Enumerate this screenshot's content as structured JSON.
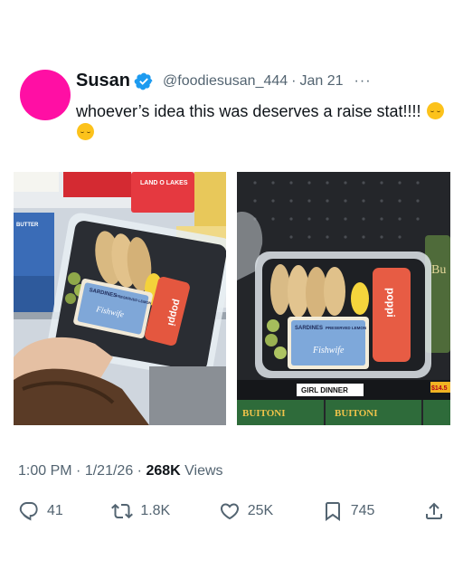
{
  "tweet": {
    "author": {
      "display_name": "Susan",
      "handle": "@foodiesusan_444",
      "verified": true,
      "avatar_color": "#ff0fa4"
    },
    "date": "Jan 21",
    "separator": "·",
    "text": "whoever’s idea this was deserves a raise stat!!!!",
    "emoji": [
      "relieved-face",
      "relieved-face"
    ],
    "media": {
      "left": {
        "labels": [
          "LAND O LAKES",
          "BUTTER",
          "SARDINES",
          "PRESERVED LEMON",
          "Fishwife",
          "poppi"
        ]
      },
      "right": {
        "labels": [
          "SARDINES",
          "PRESERVED LEMON",
          "Fishwife",
          "poppi",
          "GIRL DINNER",
          "BUITONI",
          "BUITONI",
          "$14.5",
          "Bu"
        ]
      }
    },
    "posted": {
      "time": "1:00 PM",
      "date": "1/21/26",
      "views_count": "268K",
      "views_label": "Views"
    },
    "actions": {
      "replies": "41",
      "reposts": "1.8K",
      "likes": "25K",
      "bookmarks": "745"
    }
  },
  "colors": {
    "text": "#0f1419",
    "secondary": "#536471",
    "verified": "#1d9bf0"
  }
}
